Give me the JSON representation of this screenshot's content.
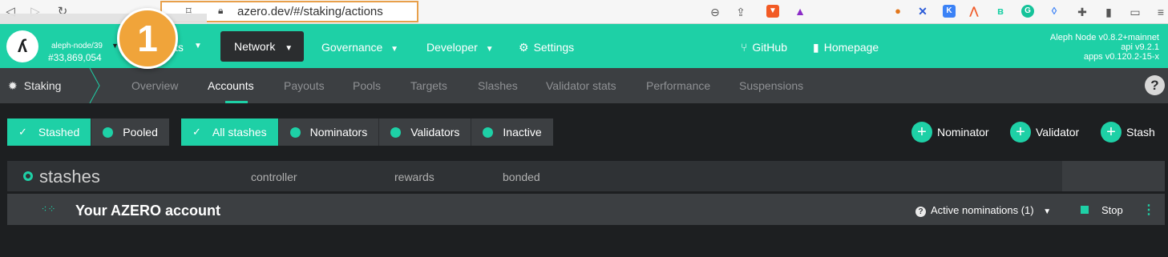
{
  "browser": {
    "url": "azero.dev/#/staking/actions"
  },
  "overlay": {
    "step_number": "1"
  },
  "header": {
    "node_name": "aleph-node/39",
    "block_number": "#33,869,054",
    "accounts_fragment": "ts",
    "menu": {
      "network": "Network",
      "governance": "Governance",
      "developer": "Developer",
      "settings": "Settings",
      "github": "GitHub",
      "homepage": "Homepage"
    },
    "version": {
      "node": "Aleph Node v0.8.2+mainnet",
      "api": "api v9.2.1",
      "apps": "apps v0.120.2-15-x"
    }
  },
  "subnav": {
    "section": "Staking",
    "tabs": [
      "Overview",
      "Accounts",
      "Payouts",
      "Pools",
      "Targets",
      "Slashes",
      "Validator stats",
      "Performance",
      "Suspensions"
    ],
    "active_tab": "Accounts",
    "help": "?"
  },
  "filters": {
    "type": [
      "Stashed",
      "Pooled"
    ],
    "role": [
      "All stashes",
      "Nominators",
      "Validators",
      "Inactive"
    ]
  },
  "actions": {
    "nominator": "Nominator",
    "validator": "Validator",
    "stash": "Stash"
  },
  "table": {
    "title": "stashes",
    "columns": [
      "controller",
      "rewards",
      "bonded"
    ],
    "row": {
      "account_name": "Your AZERO account",
      "nominations": "Active nominations (1)",
      "stop": "Stop"
    }
  },
  "colors": {
    "accent": "#1ed0a6",
    "background": "#1d1f21",
    "panel": "#3c3f42",
    "badge": "#f0a43a"
  }
}
